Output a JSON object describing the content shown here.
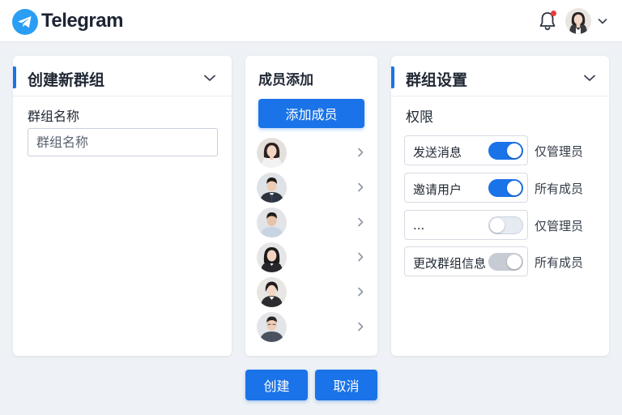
{
  "app": {
    "title": "Telegram"
  },
  "header": {
    "notification_icon": "bell-icon",
    "notification_dot_color": "#ef3a3a",
    "user_menu_icon": "chevron-down-icon"
  },
  "create_group": {
    "title": "创建新群组",
    "name_label": "群组名称",
    "name_value": "",
    "name_placeholder": "群组名称"
  },
  "members": {
    "title": "成员添加",
    "add_button": "添加成员",
    "list": [
      {
        "avatar": "female-avatar"
      },
      {
        "avatar": "male-avatar"
      },
      {
        "avatar": "male-avatar"
      },
      {
        "avatar": "female-avatar"
      },
      {
        "avatar": "female-avatar"
      },
      {
        "avatar": "male-avatar"
      }
    ]
  },
  "settings": {
    "title": "群组设置",
    "permissions_label": "权限",
    "permissions": [
      {
        "label": "发送消息",
        "enabled": true,
        "scope": "仅管理员"
      },
      {
        "label": "邀请用户",
        "enabled": true,
        "scope": "所有成员"
      },
      {
        "label": "...",
        "enabled": false,
        "scope": "仅管理员"
      },
      {
        "label": "更改群组信息",
        "enabled": true,
        "disabled": true,
        "scope": "所有成员"
      }
    ]
  },
  "actions": {
    "create": "创建",
    "cancel": "取消"
  },
  "colors": {
    "accent": "#1a73e8",
    "background": "#eef1f5",
    "panel": "#ffffff"
  }
}
